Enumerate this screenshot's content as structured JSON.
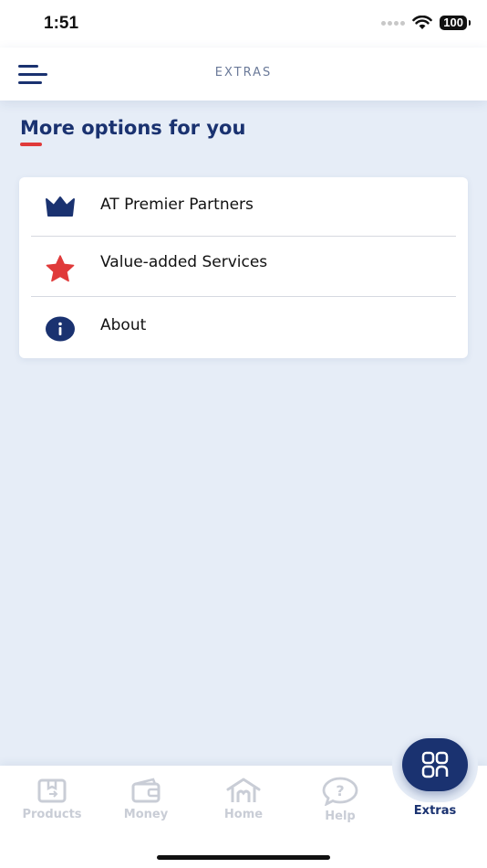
{
  "status_bar": {
    "time": "1:51",
    "battery": "100"
  },
  "header": {
    "title": "EXTRAS",
    "menu_icon": "hamburger-menu-icon"
  },
  "section": {
    "title": "More options for you"
  },
  "options": [
    {
      "label": "AT Premier Partners",
      "icon": "crown-icon"
    },
    {
      "label": "Value-added Services",
      "icon": "star-icon"
    },
    {
      "label": "About",
      "icon": "info-icon"
    }
  ],
  "bottom_nav": {
    "items": [
      {
        "label": "Products",
        "icon": "box-icon",
        "active": false
      },
      {
        "label": "Money",
        "icon": "wallet-icon",
        "active": false
      },
      {
        "label": "Home",
        "icon": "home-icon",
        "active": false
      },
      {
        "label": "Help",
        "icon": "help-icon",
        "active": false
      },
      {
        "label": "Extras",
        "icon": "grid-icon",
        "active": true
      }
    ]
  },
  "colors": {
    "brand_navy": "#1a3270",
    "accent_red": "#e03a3a",
    "background": "#e6edf7",
    "inactive_nav": "#c9cdd6"
  }
}
